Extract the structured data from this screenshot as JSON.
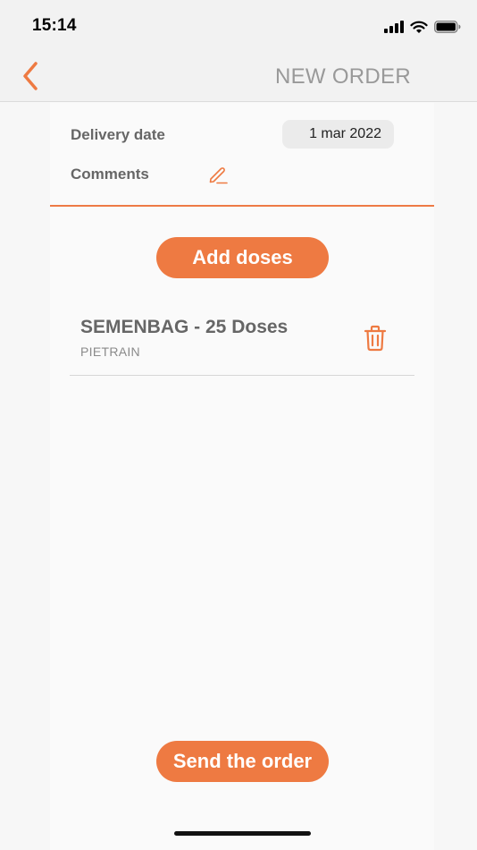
{
  "status_bar": {
    "time": "15:14",
    "icons": [
      "signal-icon",
      "wifi-icon",
      "battery-icon"
    ]
  },
  "nav": {
    "back_icon": "chevron-left-icon",
    "title": "NEW ORDER"
  },
  "form": {
    "delivery_date_label": "Delivery date",
    "delivery_date_value": "1 mar 2022",
    "comments_label": "Comments",
    "comments_icon": "pencil-icon"
  },
  "actions": {
    "add_doses_label": "Add doses",
    "send_order_label": "Send the order"
  },
  "order_items": [
    {
      "title": "SEMENBAG - 25 Doses",
      "subtitle": "PIETRAIN",
      "delete_icon": "trash-icon"
    }
  ],
  "colors": {
    "accent": "#ee7a42",
    "header_bg": "#f2f2f2",
    "content_bg": "#fafafa"
  }
}
